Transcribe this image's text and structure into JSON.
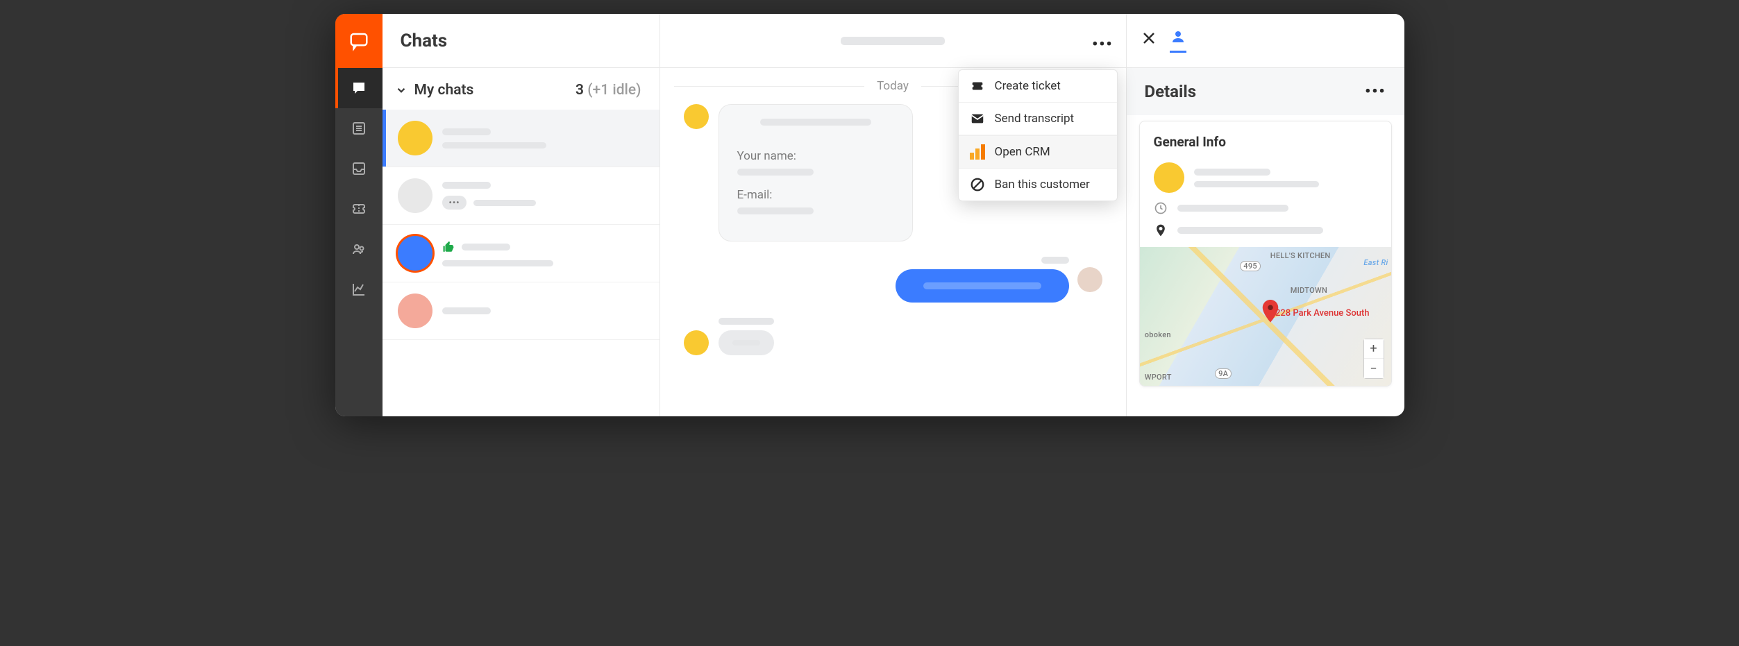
{
  "header": {
    "title": "Chats"
  },
  "sidebar": {
    "header_label": "My chats",
    "count": "3",
    "idle": "(+1 idle)"
  },
  "chat_list": [
    {
      "avatar_color": "#f9c931"
    },
    {
      "avatar_color": "#e8e8e8",
      "pill": "•••"
    },
    {
      "avatar_color": "#3b7cff",
      "ring": true,
      "thumbs": true
    },
    {
      "avatar_color": "#f4a99a"
    }
  ],
  "conversation": {
    "date": "Today",
    "form": {
      "name_label": "Your name:",
      "email_label": "E-mail:"
    }
  },
  "menu": {
    "create_ticket": "Create ticket",
    "send_transcript": "Send transcript",
    "open_crm": "Open CRM",
    "ban_customer": "Ban this customer"
  },
  "details": {
    "title": "Details",
    "general_info": "General Info",
    "neighborhood1": "HELL'S KITCHEN",
    "neighborhood2": "MIDTOWN",
    "neighborhood3": "oboken",
    "neighborhood4": "WPORT",
    "road1": "495",
    "road2": "9A",
    "river": "East Ri",
    "address": "228 Park Avenue South"
  }
}
